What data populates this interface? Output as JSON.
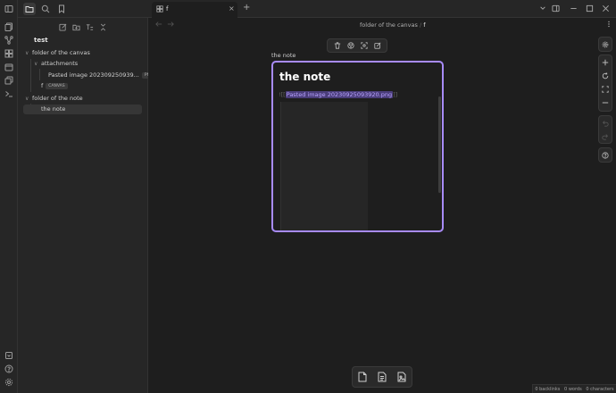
{
  "sidebar": {
    "vault_name": "test",
    "tree": [
      {
        "label": "folder of the canvas",
        "chevron": "∨"
      },
      {
        "label": "attachments",
        "chevron": "∨"
      },
      {
        "label": "Pasted image 202309250939...",
        "badge": "PNG"
      },
      {
        "label": "f",
        "badge": "CANVAS"
      },
      {
        "label": "folder of the note",
        "chevron": "∨"
      },
      {
        "label": "the note"
      }
    ]
  },
  "tab": {
    "label": "f",
    "close": "×",
    "new": "+"
  },
  "breadcrumb": {
    "folder": "folder of the canvas",
    "separator": "/",
    "file": "f"
  },
  "canvas": {
    "node_label": "the note",
    "node_title": "the note",
    "embed_open": "![[",
    "embed_text": "Pasted image 20230925093920.png",
    "embed_close": "]]"
  },
  "status": {
    "backlinks": "0 backlinks",
    "words": "0 words",
    "chars": "0 characters"
  },
  "colors": {
    "accent": "#a88bfa",
    "background": "#1e1e1e",
    "panel": "#262626"
  }
}
